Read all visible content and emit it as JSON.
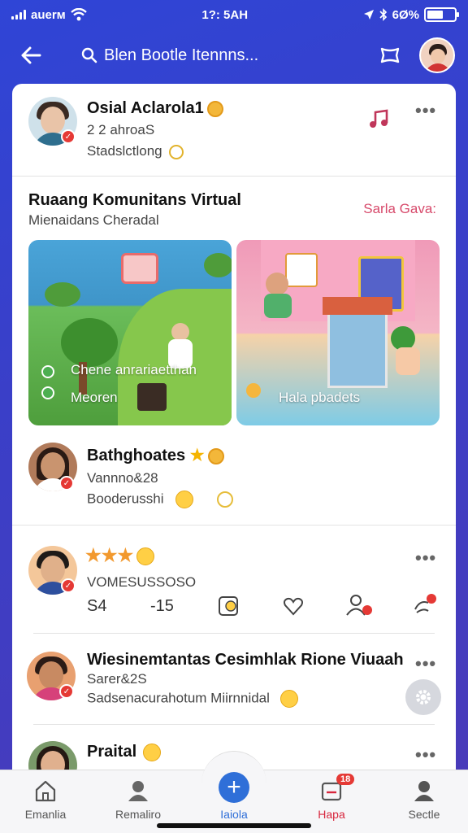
{
  "status": {
    "carrier": "auerм",
    "time": "1?: 5AH",
    "battery": "6Ø%",
    "battery_level": 0.6
  },
  "nav": {
    "search_text": "Blen Bootle Itennns...",
    "icons": [
      "back-arrow-icon",
      "search-icon",
      "map-icon"
    ]
  },
  "posts": [
    {
      "name": "Osial Aclarola1",
      "line1": "2 2 ahroaS",
      "line2": "Stadslctlong"
    }
  ],
  "section": {
    "title": "Ruaang Komunitans Virtual",
    "subtitle": "Mienaidans Cheradal",
    "link": "Sarla Gava:",
    "tiles": [
      {
        "label1": "Chene anrariaetthan",
        "label2": "Meoren"
      },
      {
        "label1": "Hala pbadets"
      }
    ]
  },
  "post2": {
    "name": "Bathghoates",
    "line1": "Vannno&28",
    "line2": "Booderusshi"
  },
  "post3": {
    "line1": "VOMESUSSOSO",
    "stat1": "S4",
    "stat2": "-15",
    "rating": 3
  },
  "post4": {
    "name": "Wiesinemtantas Cesimhlak Rione Viuaah",
    "line1": "Sarer&2S",
    "line2": "Sadsenacurahotum Miirnnidal"
  },
  "post5": {
    "name": "Praital"
  },
  "tabs": [
    {
      "label": "Emanlia",
      "icon": "home-icon"
    },
    {
      "label": "Remaliro",
      "icon": "profile-icon"
    },
    {
      "label": "Iaiola",
      "icon": "add-icon"
    },
    {
      "label": "Hapa",
      "icon": "inbox-icon",
      "badge": "18"
    },
    {
      "label": "Sectle",
      "icon": "user-icon"
    }
  ],
  "colors": {
    "header": "#3444d0",
    "accent_link": "#d74a6b",
    "tab_active": "#2f6fd8",
    "badge": "#e53935"
  }
}
